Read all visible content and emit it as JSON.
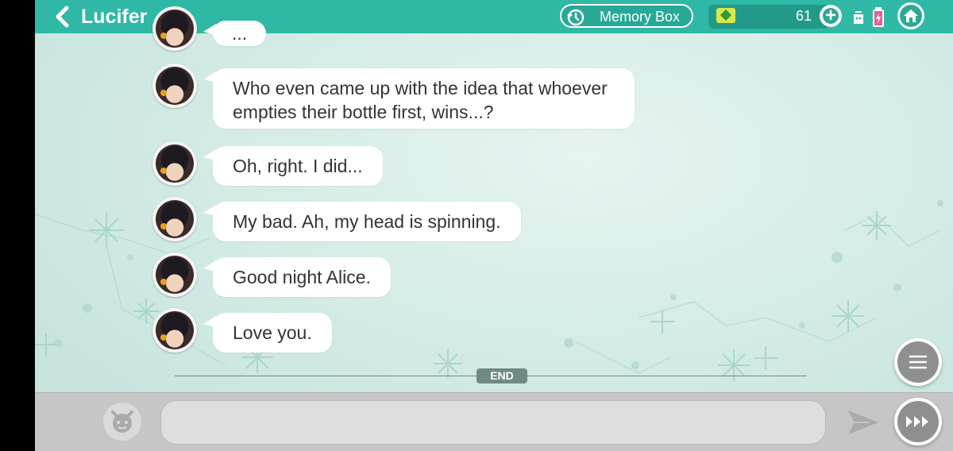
{
  "header": {
    "back_icon": "chevron-left-icon",
    "title": "Lucifer",
    "memory_box_label": "Memory Box",
    "currency_count": "61",
    "colors": {
      "header_bg": "#2fb8a6",
      "text": "#ffffff"
    }
  },
  "messages": [
    {
      "sender": "Lucifer",
      "text": "..."
    },
    {
      "sender": "Lucifer",
      "line1": "Who even came up with the idea that whoever",
      "line2": "empties their bottle first, wins...?"
    },
    {
      "sender": "Lucifer",
      "text": "Oh, right. I did..."
    },
    {
      "sender": "Lucifer",
      "text": "My bad. Ah, my head is spinning."
    },
    {
      "sender": "Lucifer",
      "text": "Good night Alice."
    },
    {
      "sender": "Lucifer",
      "text": "Love you."
    }
  ],
  "end_label": "END",
  "input": {
    "placeholder": ""
  }
}
